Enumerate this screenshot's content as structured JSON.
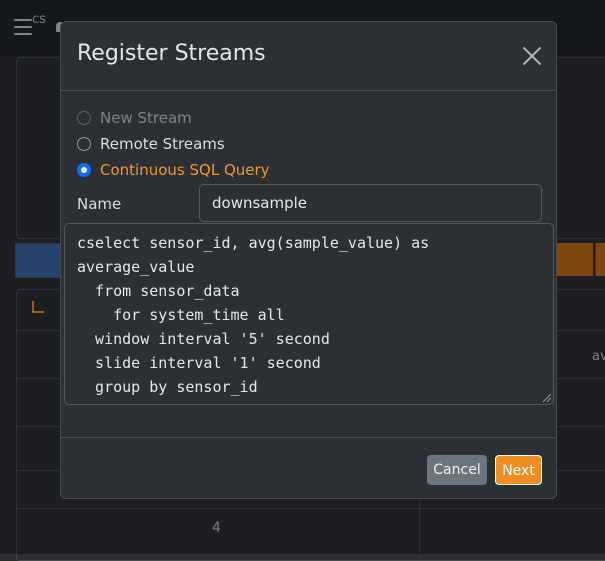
{
  "background": {
    "card_top_label": "cs",
    "column_label": "av",
    "row_number": "4"
  },
  "modal": {
    "title": "Register Streams",
    "options": [
      {
        "label": "New Stream",
        "state": "disabled"
      },
      {
        "label": "Remote Streams",
        "state": "unchecked"
      },
      {
        "label": "Continuous SQL Query",
        "state": "checked"
      }
    ],
    "name_label": "Name",
    "name_value": "downsample",
    "query_text": "cselect sensor_id, avg(sample_value) as\naverage_value\n  from sensor_data\n    for system_time all\n  window interval '5' second\n  slide interval '1' second\n  group by sensor_id",
    "cancel_label": "Cancel",
    "next_label": "Next"
  },
  "colors": {
    "accent": "#f0962d",
    "radio_checked": "#0d6efd",
    "cancel_button": "#6c757d",
    "next_button": "#ef8d22"
  }
}
